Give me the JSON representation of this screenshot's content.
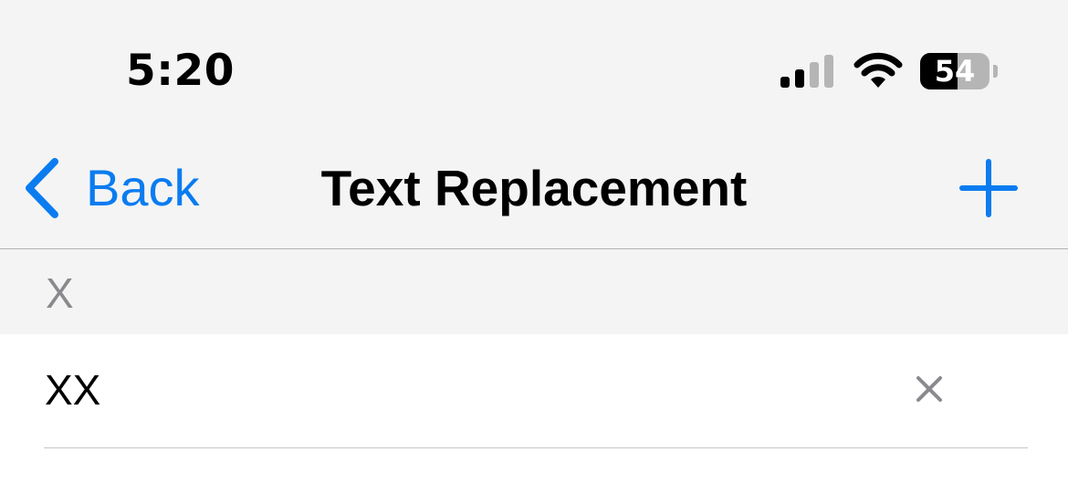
{
  "status_bar": {
    "time": "5:20",
    "battery_percent": "54",
    "battery_level": 0.54,
    "signal_icon": "cellular-signal-icon",
    "wifi_icon": "wifi-icon",
    "battery_icon": "battery-icon"
  },
  "nav": {
    "back_label": "Back",
    "back_icon": "chevron-left-icon",
    "title": "Text Replacement",
    "add_icon": "plus-icon"
  },
  "list": {
    "section_header": "X",
    "rows": [
      {
        "shortcut": "XX",
        "clear_icon": "close-icon"
      }
    ]
  },
  "colors": {
    "accent": "#0a7cf0",
    "header_background": "#f4f4f4",
    "secondary_text": "#8a8a8e"
  }
}
